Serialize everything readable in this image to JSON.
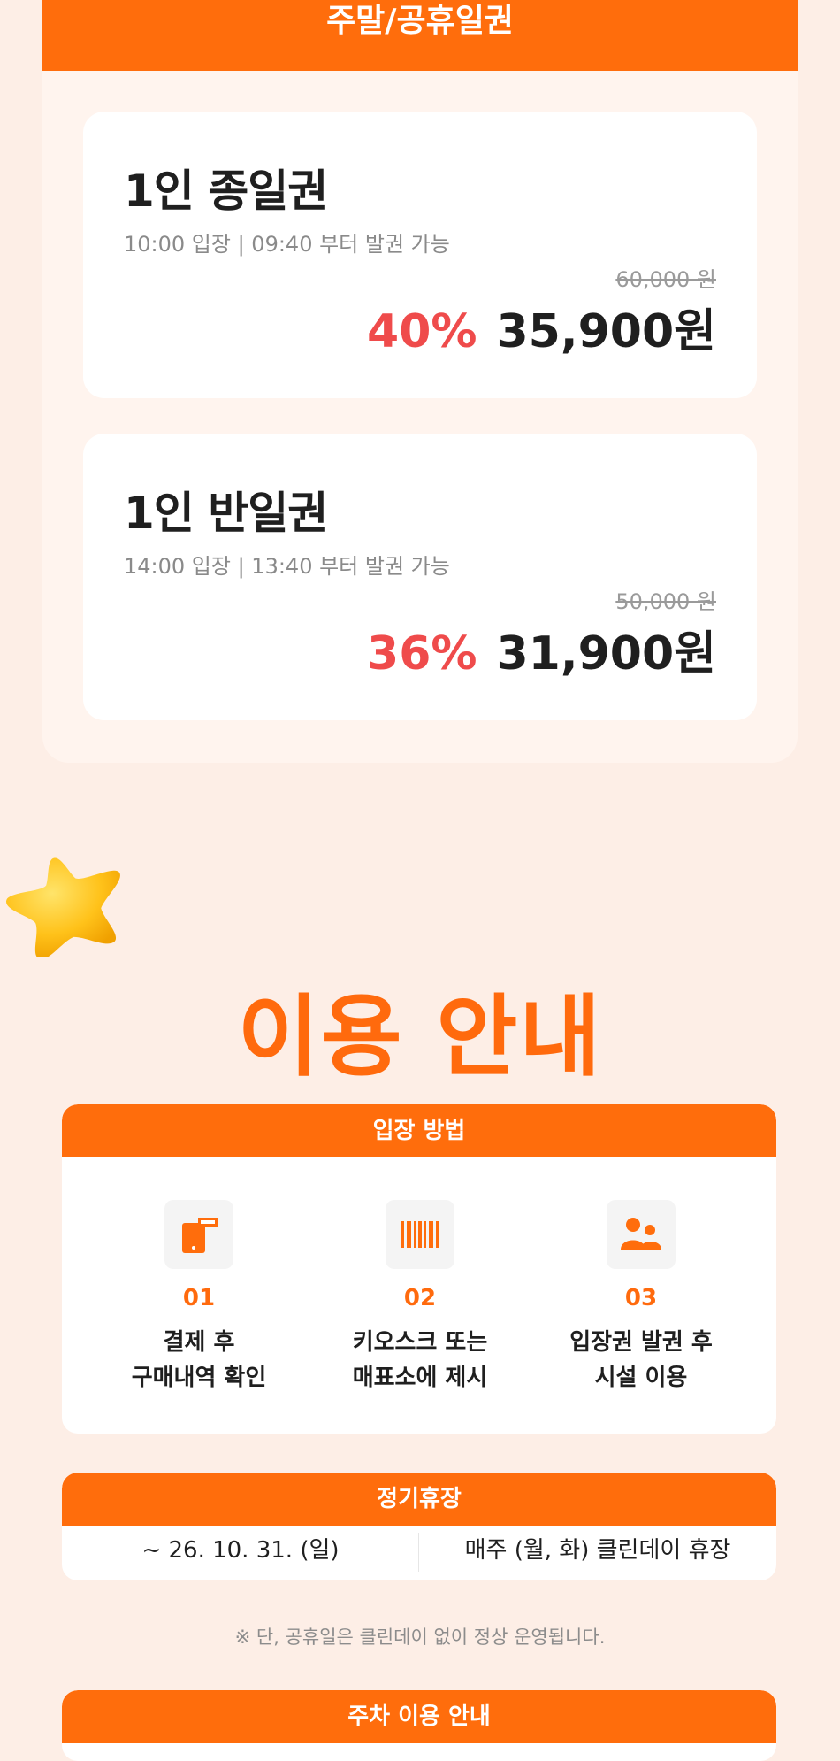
{
  "weekend": {
    "header": "주말/공휴일권",
    "tickets": [
      {
        "name": "1인 종일권",
        "sub": "10:00 입장 | 09:40 부터 발권 가능",
        "original_price": "60,000 원",
        "discount": "40%",
        "price": "35,900원"
      },
      {
        "name": "1인 반일권",
        "sub": "14:00 입장 | 13:40 부터 발권 가능",
        "original_price": "50,000 원",
        "discount": "36%",
        "price": "31,900원"
      }
    ]
  },
  "guide": {
    "title": "이용 안내",
    "entry": {
      "header": "입장 방법",
      "steps": [
        {
          "num": "01",
          "line1": "결제 후",
          "line2": "구매내역 확인",
          "icon": "phone-ticket-icon"
        },
        {
          "num": "02",
          "line1": "키오스크 또는",
          "line2": "매표소에 제시",
          "icon": "barcode-icon"
        },
        {
          "num": "03",
          "line1": "입장권 발권 후",
          "line2": "시설 이용",
          "icon": "people-icon"
        }
      ]
    },
    "closed": {
      "header": "정기휴장",
      "period": "~ 26. 10. 31. (일)",
      "detail": "매주 (월, 화) 클린데이 휴장"
    },
    "note": "※ 단, 공휴일은 클린데이 없이 정상 운영됩니다.",
    "parking": {
      "header": "주차 이용 안내"
    }
  },
  "colors": {
    "accent": "#ff6d0c",
    "discount": "#ef4b4b",
    "background": "#fdeee6"
  }
}
